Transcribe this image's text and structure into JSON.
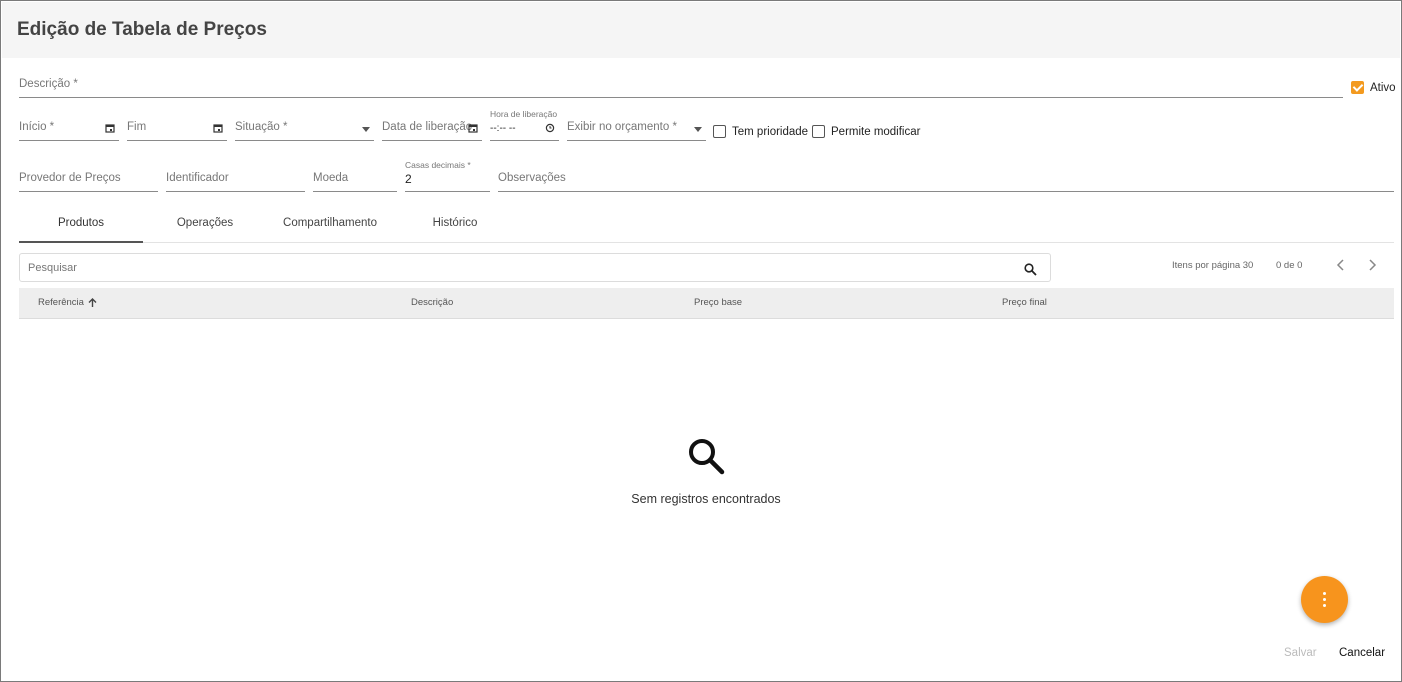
{
  "page": {
    "title": "Edição de Tabela de Preços"
  },
  "form": {
    "descricao_label": "Descrição *",
    "ativo_label": "Ativo",
    "ativo_checked": true,
    "inicio_label": "Início *",
    "fim_label": "Fim",
    "situacao_label": "Situação *",
    "data_liberacao_label": "Data de liberação",
    "hora_liberacao_label": "Hora de liberação",
    "hora_liberacao_value": "--:-- --",
    "exibir_orcamento_label": "Exibir no orçamento *",
    "tem_prioridade_label": "Tem prioridade",
    "permite_modificar_label": "Permite modificar",
    "provedor_label": "Provedor de Preços",
    "identificador_label": "Identificador",
    "moeda_label": "Moeda",
    "casas_decimais_label": "Casas decimais *",
    "casas_decimais_value": "2",
    "observacoes_label": "Observações"
  },
  "tabs": [
    {
      "label": "Produtos",
      "active": true
    },
    {
      "label": "Operações",
      "active": false
    },
    {
      "label": "Compartilhamento",
      "active": false
    },
    {
      "label": "Histórico",
      "active": false
    }
  ],
  "grid": {
    "search_placeholder": "Pesquisar",
    "items_per_page": "Itens por página 30",
    "range": "0 de 0",
    "columns": [
      "Referência",
      "Descrição",
      "Preço base",
      "Preço final"
    ],
    "empty_message": "Sem registros encontrados"
  },
  "actions": {
    "save": "Salvar",
    "cancel": "Cancelar"
  },
  "colors": {
    "accent": "#f7941d"
  }
}
